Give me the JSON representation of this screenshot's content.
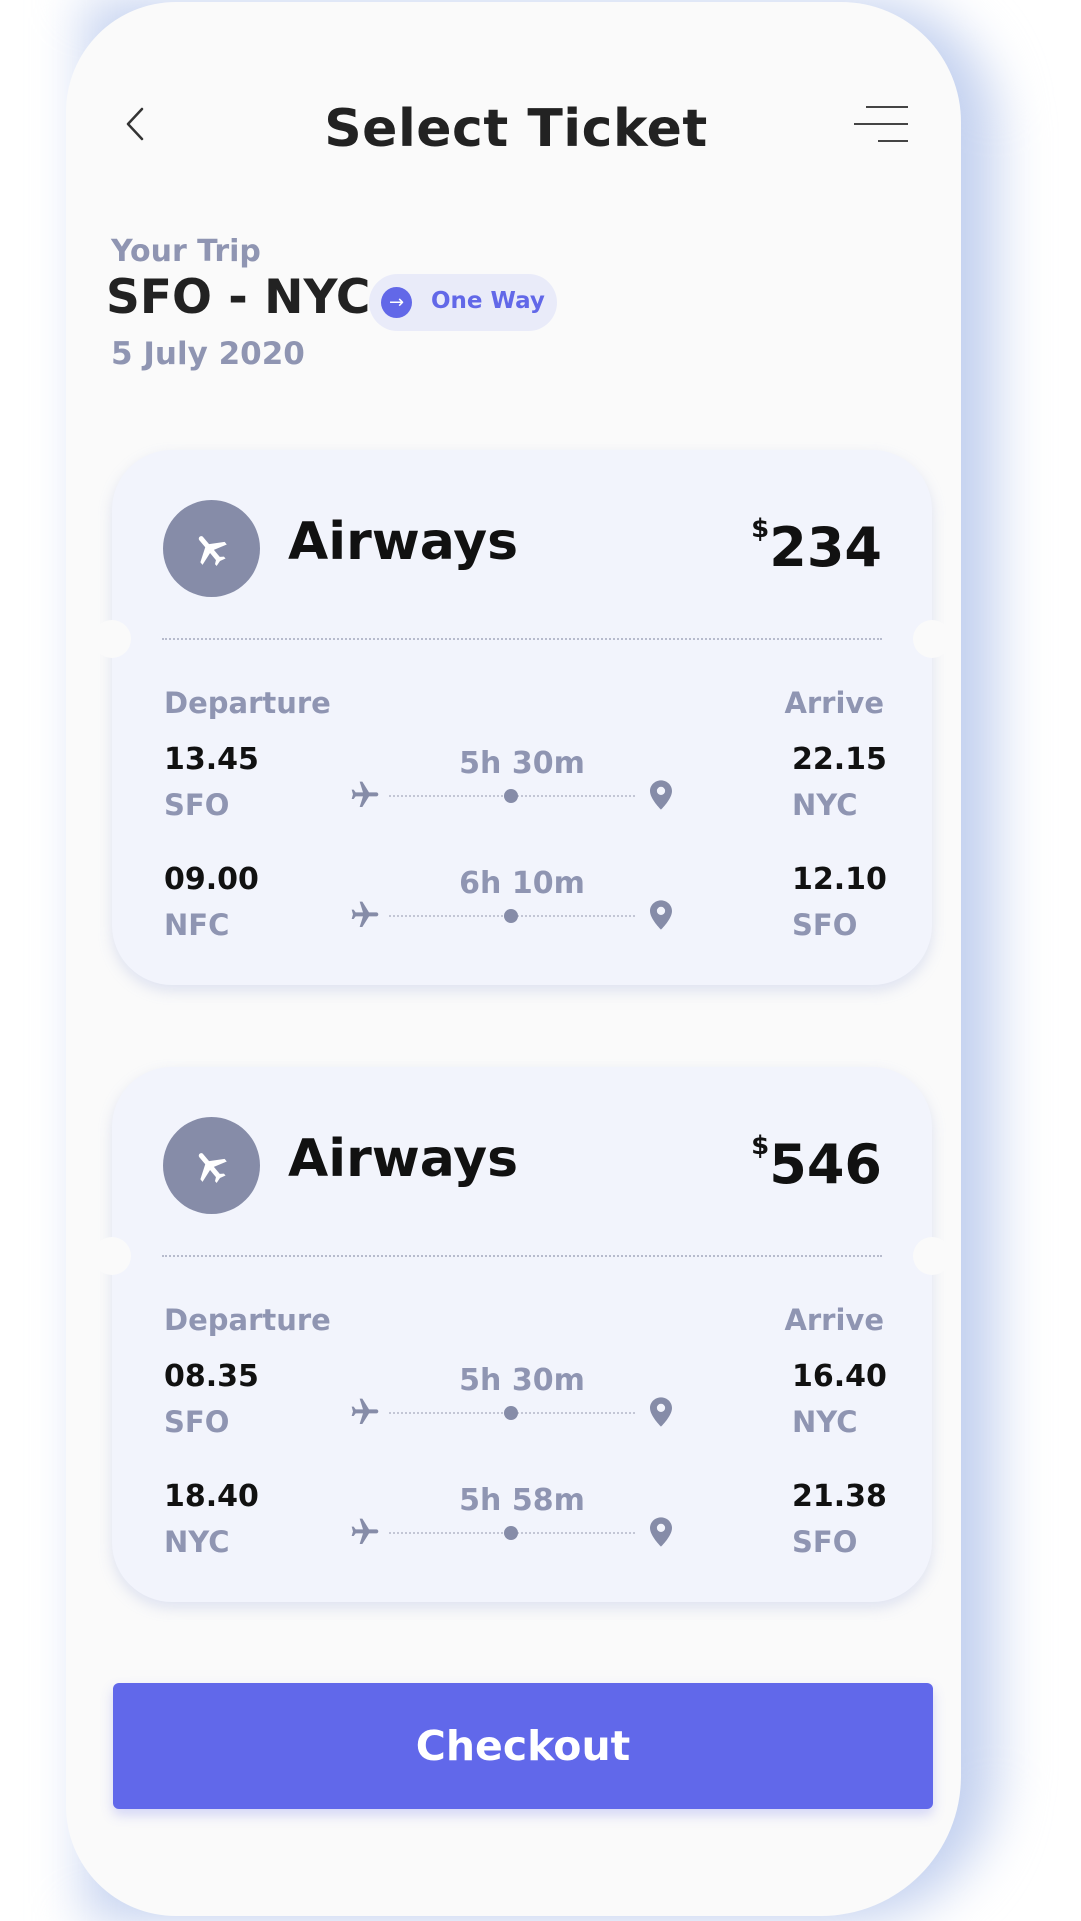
{
  "header": {
    "title": "Select Ticket",
    "back_icon": "chevron-left-icon",
    "menu_icon": "menu-icon"
  },
  "trip": {
    "label": "Your Trip",
    "route": "SFO - NYC",
    "date": "5 July 2020",
    "mode_label": "One Way",
    "mode_icon": "→"
  },
  "tickets": [
    {
      "airline": "Airways",
      "currency": "$",
      "price": "234",
      "departure_header": "Departure",
      "arrive_header": "Arrive",
      "legs": [
        {
          "dep_time": "13.45",
          "dep_code": "SFO",
          "duration": "5h 30m",
          "arr_time": "22.15",
          "arr_code": "NYC"
        },
        {
          "dep_time": "09.00",
          "dep_code": "NFC",
          "duration": "6h 10m",
          "arr_time": "12.10",
          "arr_code": "SFO"
        }
      ]
    },
    {
      "airline": "Airways",
      "currency": "$",
      "price": "546",
      "departure_header": "Departure",
      "arrive_header": "Arrive",
      "legs": [
        {
          "dep_time": "08.35",
          "dep_code": "SFO",
          "duration": "5h 30m",
          "arr_time": "16.40",
          "arr_code": "NYC"
        },
        {
          "dep_time": "18.40",
          "dep_code": "NYC",
          "duration": "5h 58m",
          "arr_time": "21.38",
          "arr_code": "SFO"
        }
      ]
    }
  ],
  "checkout": {
    "label": "Checkout"
  },
  "colors": {
    "accent": "#6168ea",
    "muted_text": "#8f95b2",
    "ticket_bg": "#f2f4fc",
    "pill_bg": "#e9ebf9"
  }
}
